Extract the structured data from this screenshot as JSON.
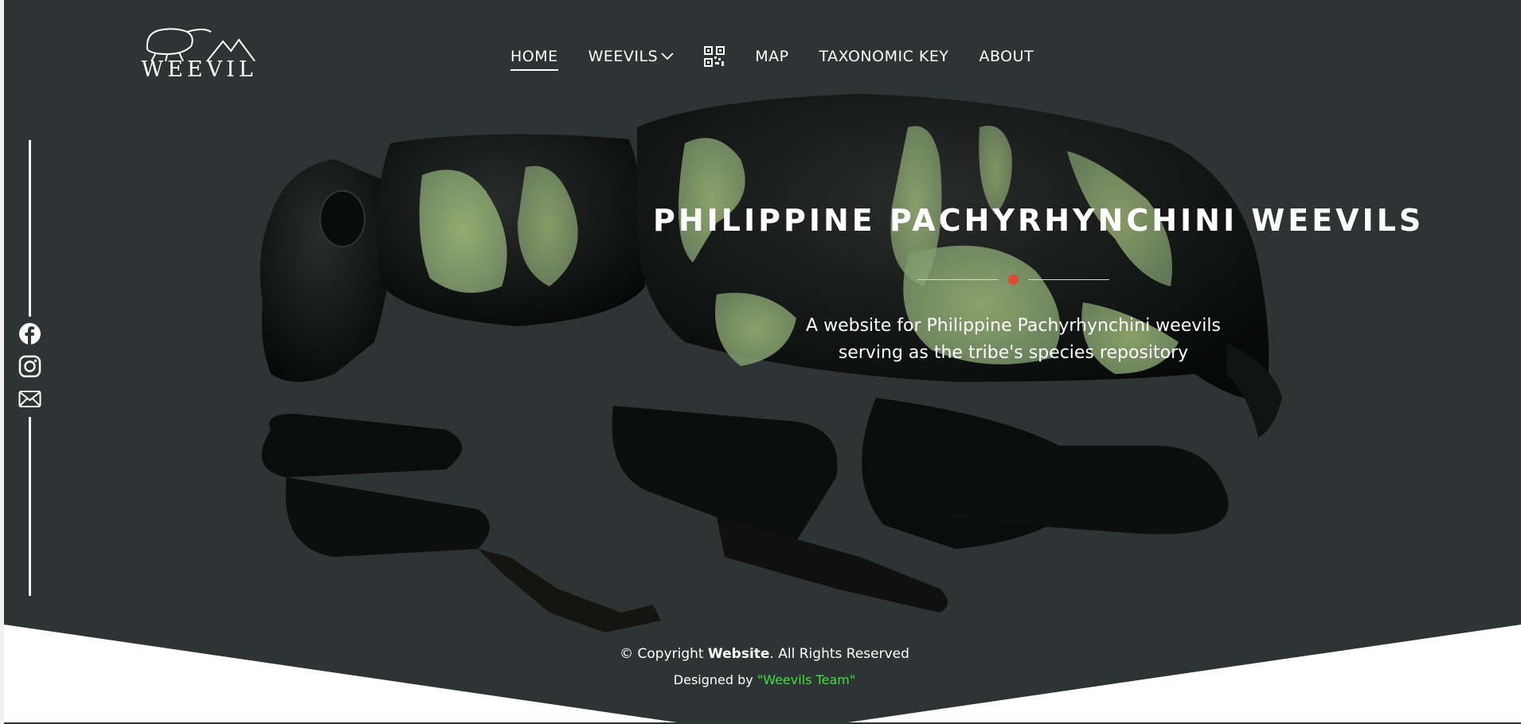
{
  "brand": {
    "logo_text": "WEEVIL"
  },
  "nav": {
    "items": [
      {
        "label": "HOME",
        "active": true
      },
      {
        "label": "WEEVILS",
        "has_dropdown": true
      },
      {
        "label": "qr-code-icon",
        "icon": true
      },
      {
        "label": "MAP"
      },
      {
        "label": "TAXONOMIC KEY"
      },
      {
        "label": "ABOUT"
      }
    ]
  },
  "social": {
    "icons": [
      "facebook-icon",
      "instagram-icon",
      "mail-icon"
    ]
  },
  "hero": {
    "title": "PHILIPPINE PACHYRHYNCHINI WEEVILS",
    "subtitle_line1": "A website for Philippine Pachyrhynchini weevils",
    "subtitle_line2": "serving as the tribe's species repository"
  },
  "footer": {
    "copyright_prefix": "© Copyright",
    "copyright_brand": "Website",
    "copyright_suffix": ". All Rights Reserved",
    "designed_prefix": "Designed by",
    "designed_team": "\"Weevils Team\""
  },
  "colors": {
    "background": "#2e3433",
    "accent_dot": "#e04b36",
    "team_green": "#3fe03f",
    "footer_white": "#ffffff"
  }
}
